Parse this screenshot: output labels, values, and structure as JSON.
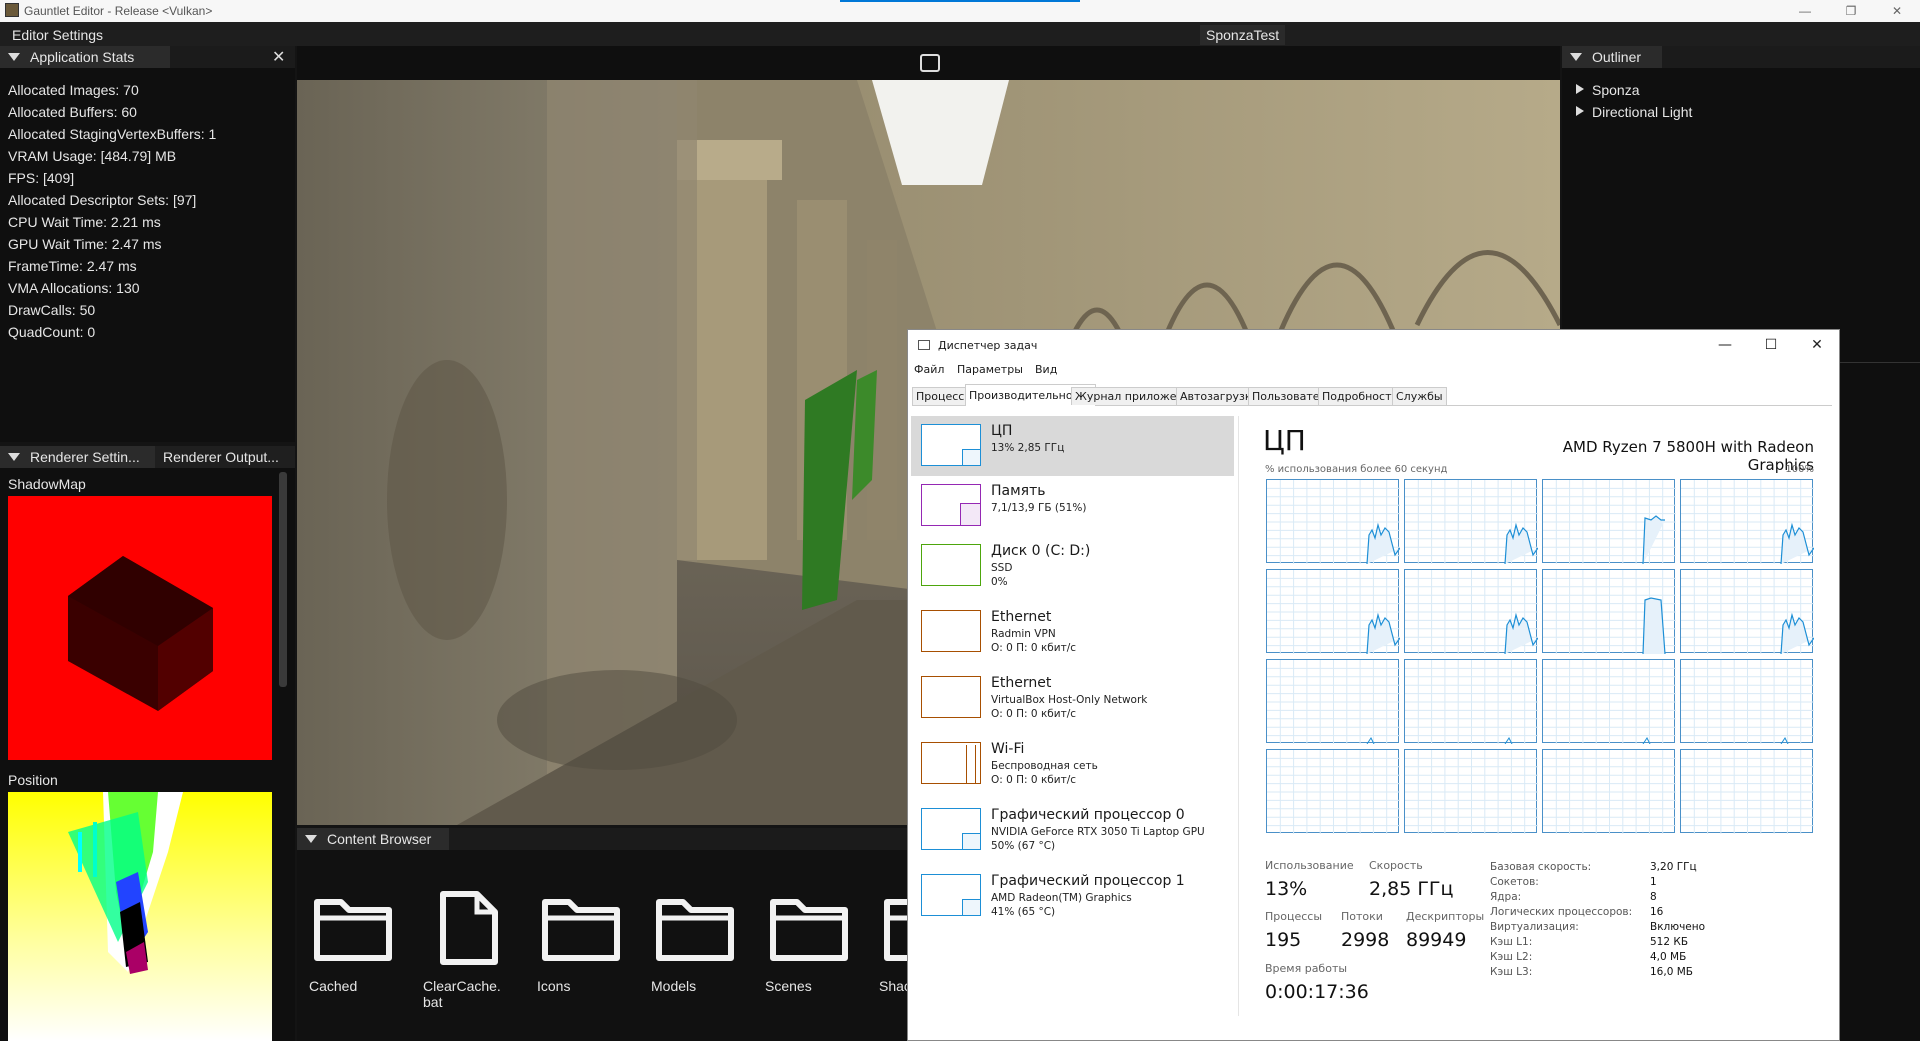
{
  "window": {
    "title": "Gauntlet Editor - Release <Vulkan>"
  },
  "menubar": {
    "menu": "Editor Settings",
    "scene_tab": "SponzaTest"
  },
  "stats_panel": {
    "tab": "Application Stats",
    "lines": [
      "Allocated Images: 70",
      "Allocated Buffers: 60",
      "Allocated StagingVertexBuffers: 1",
      "VRAM Usage: [484.79] MB",
      "FPS: [409]",
      "Allocated Descriptor Sets: [97]",
      "CPU Wait Time: 2.21 ms",
      "GPU Wait Time: 2.47 ms",
      "FrameTime: 2.47 ms",
      "VMA Allocations: 130",
      "DrawCalls: 50",
      "QuadCount: 0"
    ]
  },
  "renderer_panel": {
    "tab1": "Renderer Settin...",
    "tab2": "Renderer Output...",
    "shadow_label": "ShadowMap",
    "position_label": "Position"
  },
  "content_browser": {
    "tab": "Content Browser",
    "items": [
      {
        "label": "Cached",
        "icon": "folder-icon"
      },
      {
        "label": "ClearCache.\nbat",
        "icon": "file-icon"
      },
      {
        "label": "Icons",
        "icon": "folder-icon"
      },
      {
        "label": "Models",
        "icon": "folder-icon"
      },
      {
        "label": "Scenes",
        "icon": "folder-icon"
      },
      {
        "label": "Shac",
        "icon": "folder-icon"
      }
    ]
  },
  "outliner": {
    "tab": "Outliner",
    "items": [
      "Sponza",
      "Directional Light"
    ]
  },
  "task_manager": {
    "title": "Диспетчер задач",
    "menu": [
      "Файл",
      "Параметры",
      "Вид"
    ],
    "tabs": [
      "Процессы",
      "Производительность",
      "Журнал приложений",
      "Автозагрузка",
      "Пользователи",
      "Подробности",
      "Службы"
    ],
    "active_tab": "Производительность",
    "resources": [
      {
        "name": "ЦП",
        "sub1": "13% 2,85 ГГц",
        "sub2": "",
        "sub3": "",
        "color": "#1d8fd6"
      },
      {
        "name": "Память",
        "sub1": "7,1/13,9 ГБ (51%)",
        "sub2": "",
        "sub3": "",
        "color": "#9528b4"
      },
      {
        "name": "Диск 0 (C: D:)",
        "sub1": "SSD",
        "sub2": "0%",
        "sub3": "",
        "color": "#4da60c"
      },
      {
        "name": "Ethernet",
        "sub1": "Radmin VPN",
        "sub2": "О: 0 П: 0 кбит/с",
        "sub3": "",
        "color": "#a74f01"
      },
      {
        "name": "Ethernet",
        "sub1": "VirtualBox Host-Only Network",
        "sub2": "О: 0 П: 0 кбит/с",
        "sub3": "",
        "color": "#a74f01"
      },
      {
        "name": "Wi-Fi",
        "sub1": "Беспроводная сеть",
        "sub2": "О: 0 П: 0 кбит/с",
        "sub3": "",
        "color": "#a74f01"
      },
      {
        "name": "Графический процессор 0",
        "sub1": "NVIDIA GeForce RTX 3050 Ti Laptop GPU",
        "sub2": "50% (67 °C)",
        "sub3": "",
        "color": "#1d8fd6"
      },
      {
        "name": "Графический процессор 1",
        "sub1": "AMD Radeon(TM) Graphics",
        "sub2": "41% (65 °C)",
        "sub3": "",
        "color": "#1d8fd6"
      }
    ],
    "cpu": {
      "heading": "ЦП",
      "model": "AMD Ryzen 7 5800H with Radeon Graphics",
      "graph_caption": "% использования более 60 секунд",
      "graph_max": "100%",
      "usage_label": "Использование",
      "usage": "13%",
      "speed_label": "Скорость",
      "speed": "2,85 ГГц",
      "proc_label": "Процессы",
      "proc": "195",
      "threads_label": "Потоки",
      "threads": "2998",
      "handles_label": "Дескрипторы",
      "handles": "89949",
      "uptime_label": "Время работы",
      "uptime": "0:00:17:36",
      "specs": [
        {
          "k": "Базовая скорость:",
          "v": "3,20 ГГц"
        },
        {
          "k": "Сокетов:",
          "v": "1"
        },
        {
          "k": "Ядра:",
          "v": "8"
        },
        {
          "k": "Логических процессоров:",
          "v": "16"
        },
        {
          "k": "Виртуализация:",
          "v": "Включено"
        },
        {
          "k": "Кэш L1:",
          "v": "512 КБ"
        },
        {
          "k": "Кэш L2:",
          "v": "4,0 МБ"
        },
        {
          "k": "Кэш L3:",
          "v": "16,0 МБ"
        }
      ]
    }
  }
}
